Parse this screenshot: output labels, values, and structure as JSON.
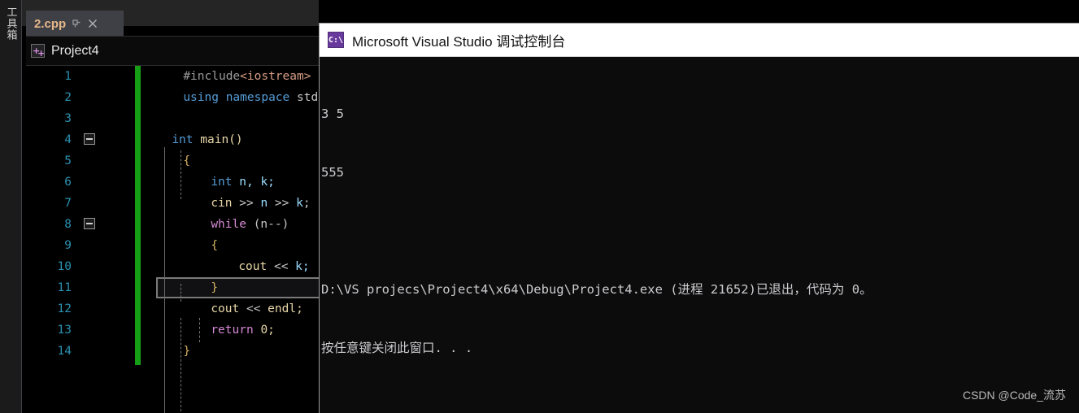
{
  "toolbox": {
    "label": "工具箱"
  },
  "editor": {
    "tab": {
      "title": "2.cpp",
      "pin_icon": "pin-icon",
      "close_icon": "close-icon"
    },
    "breadcrumb": {
      "project_icon": "cpp-project-icon",
      "project_name": "Project4"
    },
    "lines": [
      {
        "n": "1",
        "text": "#include<iostream>"
      },
      {
        "n": "2",
        "text": "using namespace std;"
      },
      {
        "n": "3",
        "text": ""
      },
      {
        "n": "4",
        "text": "int main()"
      },
      {
        "n": "5",
        "text": "{"
      },
      {
        "n": "6",
        "text": "    int n, k;"
      },
      {
        "n": "7",
        "text": "    cin >> n >> k;"
      },
      {
        "n": "8",
        "text": "    while (n--)"
      },
      {
        "n": "9",
        "text": "    {"
      },
      {
        "n": "10",
        "text": "        cout << k;"
      },
      {
        "n": "11",
        "text": "    }"
      },
      {
        "n": "12",
        "text": "    cout << endl;"
      },
      {
        "n": "13",
        "text": "    return 0;"
      },
      {
        "n": "14",
        "text": "}"
      }
    ],
    "numbers": {
      "l1": "1",
      "l2": "2",
      "l3": "3",
      "l4": "4",
      "l5": "5",
      "l6": "6",
      "l7": "7",
      "l8": "8",
      "l9": "9",
      "l10": "10",
      "l11": "11",
      "l12": "12",
      "l13": "13",
      "l14": "14"
    },
    "tokens": {
      "include_directive": "#include",
      "include_header": "<iostream>",
      "using_kw": "using",
      "namespace_kw": "namespace",
      "std_name": "std;",
      "int_kw": "int",
      "main_name": "main()",
      "open_brace": "{",
      "close_brace": "}",
      "decl_int": "int",
      "decl_vars": "n, k;",
      "cin_name": "cin",
      "shift_in": ">>",
      "var_n": "n",
      "var_k": "k",
      "semi": ";",
      "while_kw": "while",
      "while_cond": "(n--)",
      "cout_name": "cout",
      "shift_out": "<<",
      "k_semi": "k;",
      "endl_semi": "endl;",
      "return_kw": "return",
      "return_val": "0;"
    }
  },
  "console": {
    "title": "Microsoft Visual Studio 调试控制台",
    "icon": "command-prompt-icon",
    "output": [
      "3 5",
      "555",
      "",
      "D:\\VS projecs\\Project4\\x64\\Debug\\Project4.exe (进程 21652)已退出，代码为 0。",
      "按任意键关闭此窗口. . ."
    ],
    "line_0": "3 5",
    "line_1": "555",
    "line_3": "D:\\VS projecs\\Project4\\x64\\Debug\\Project4.exe (进程 21652)已退出，代码为 0。",
    "line_4": "按任意键关闭此窗口. . ."
  },
  "watermark": {
    "text": "CSDN @Code_流苏"
  },
  "colors": {
    "editor_background": "#000000",
    "line_number": "#2b91af",
    "keyword_blue": "#569cd6",
    "keyword_magenta": "#d48ad4",
    "string_header": "#d69d85",
    "identifier": "#9cdcfe",
    "changebar_green": "#15a015",
    "tab_title": "#e6b88a",
    "console_title_bar": "#ffffff",
    "console_background": "#0c0c0c"
  }
}
